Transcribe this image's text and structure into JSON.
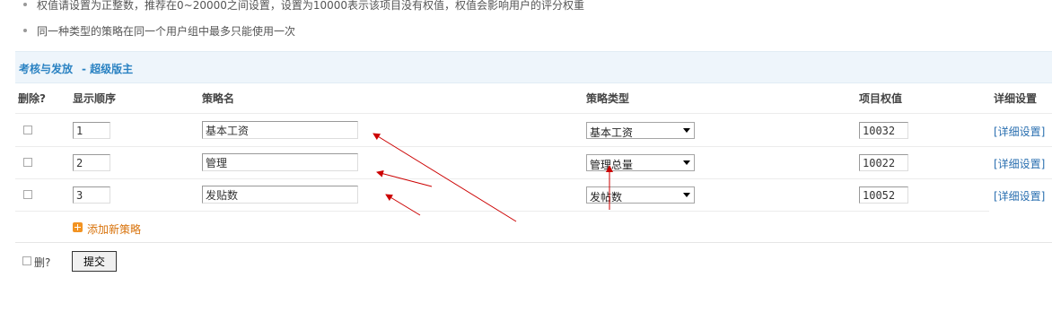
{
  "tips": [
    "权值请设置为正整数，推荐在0~20000之间设置，设置为10000表示该项目没有权值，权值会影响用户的评分权重",
    "同一种类型的策略在同一个用户组中最多只能使用一次"
  ],
  "section": {
    "title": "考核与发放",
    "subtitle": "- 超级版主"
  },
  "table": {
    "headers": {
      "delete": "删除?",
      "order": "显示顺序",
      "name": "策略名",
      "type": "策略类型",
      "weight": "项目权值",
      "detail": "详细设置"
    },
    "rows": [
      {
        "order": "1",
        "name": "基本工资",
        "type": "基本工资",
        "weight": "10032",
        "detail": "[详细设置]"
      },
      {
        "order": "2",
        "name": "管理",
        "type": "管理总量",
        "weight": "10022",
        "detail": "[详细设置]"
      },
      {
        "order": "3",
        "name": "发贴数",
        "type": "发帖数",
        "weight": "10052",
        "detail": "[详细设置]"
      }
    ]
  },
  "add_label": "添加新策略",
  "footer": {
    "delete_label": "删?",
    "submit_label": "提交"
  },
  "colors": {
    "header_bg": "#eef5fb",
    "header_text": "#2a82c2",
    "link": "#2a6fb0",
    "add_link": "#d8720a",
    "annotation": "#cc0000"
  }
}
